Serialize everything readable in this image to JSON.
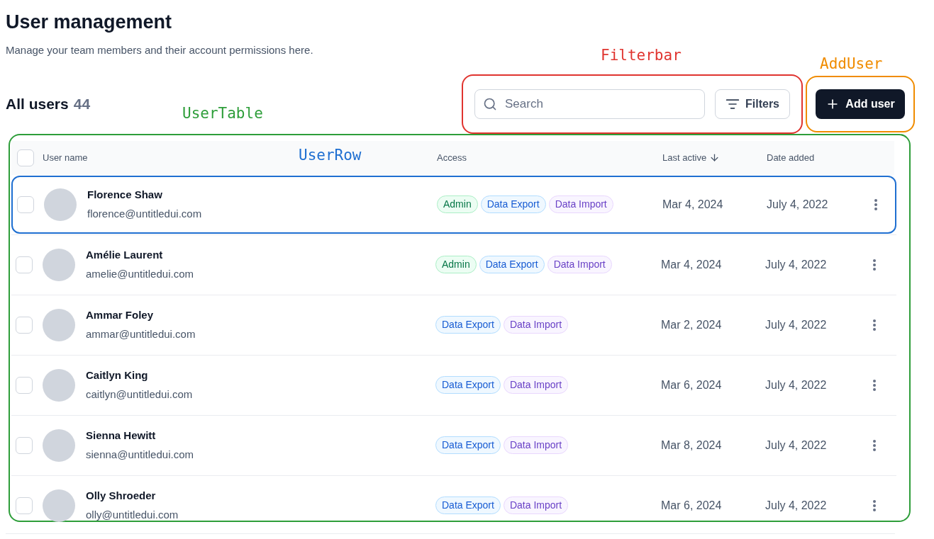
{
  "page": {
    "title": "User management",
    "subtitle": "Manage your team members and their account permissions here."
  },
  "summary": {
    "label": "All users",
    "count": "44"
  },
  "filterbar": {
    "annotation": {
      "label": "Filterbar",
      "color": "#e0342f"
    },
    "search": {
      "placeholder": "Search"
    },
    "filters_button": "Filters"
  },
  "add_user": {
    "annotation": {
      "label": "AddUser",
      "color": "#f08c00"
    },
    "button": "Add user"
  },
  "table": {
    "annotation": {
      "label": "UserTable",
      "color": "#2e9e3a"
    },
    "header_checked": false,
    "columns": [
      {
        "label": "User name",
        "sorted": false
      },
      {
        "label": "Access",
        "sorted": false
      },
      {
        "label": "Last active",
        "sorted": true
      },
      {
        "label": "Date added",
        "sorted": false
      }
    ],
    "rows": [
      {
        "name": "Florence Shaw",
        "email": "florence@untitledui.com",
        "checked": false,
        "tags": [
          {
            "label": "Admin",
            "kind": "admin"
          },
          {
            "label": "Data Export",
            "kind": "export"
          },
          {
            "label": "Data Import",
            "kind": "import"
          }
        ],
        "last_active": "Mar 4, 2024",
        "date_added": "July 4, 2022",
        "annotation": {
          "label": "UserRow",
          "color": "#1f6fd1"
        }
      },
      {
        "name": "Amélie Laurent",
        "email": "amelie@untitledui.com",
        "checked": false,
        "tags": [
          {
            "label": "Admin",
            "kind": "admin"
          },
          {
            "label": "Data Export",
            "kind": "export"
          },
          {
            "label": "Data Import",
            "kind": "import"
          }
        ],
        "last_active": "Mar 4, 2024",
        "date_added": "July 4, 2022"
      },
      {
        "name": "Ammar Foley",
        "email": "ammar@untitledui.com",
        "checked": false,
        "tags": [
          {
            "label": "Data Export",
            "kind": "export"
          },
          {
            "label": "Data Import",
            "kind": "import"
          }
        ],
        "last_active": "Mar 2, 2024",
        "date_added": "July 4, 2022"
      },
      {
        "name": "Caitlyn King",
        "email": "caitlyn@untitledui.com",
        "checked": false,
        "tags": [
          {
            "label": "Data Export",
            "kind": "export"
          },
          {
            "label": "Data Import",
            "kind": "import"
          }
        ],
        "last_active": "Mar 6, 2024",
        "date_added": "July 4, 2022"
      },
      {
        "name": "Sienna Hewitt",
        "email": "sienna@untitledui.com",
        "checked": false,
        "tags": [
          {
            "label": "Data Export",
            "kind": "export"
          },
          {
            "label": "Data Import",
            "kind": "import"
          }
        ],
        "last_active": "Mar 8, 2024",
        "date_added": "July 4, 2022"
      },
      {
        "name": "Olly Shroeder",
        "email": "olly@untitledui.com",
        "checked": false,
        "tags": [
          {
            "label": "Data Export",
            "kind": "export"
          },
          {
            "label": "Data Import",
            "kind": "import"
          }
        ],
        "last_active": "Mar 6, 2024",
        "date_added": "July 4, 2022"
      }
    ]
  }
}
